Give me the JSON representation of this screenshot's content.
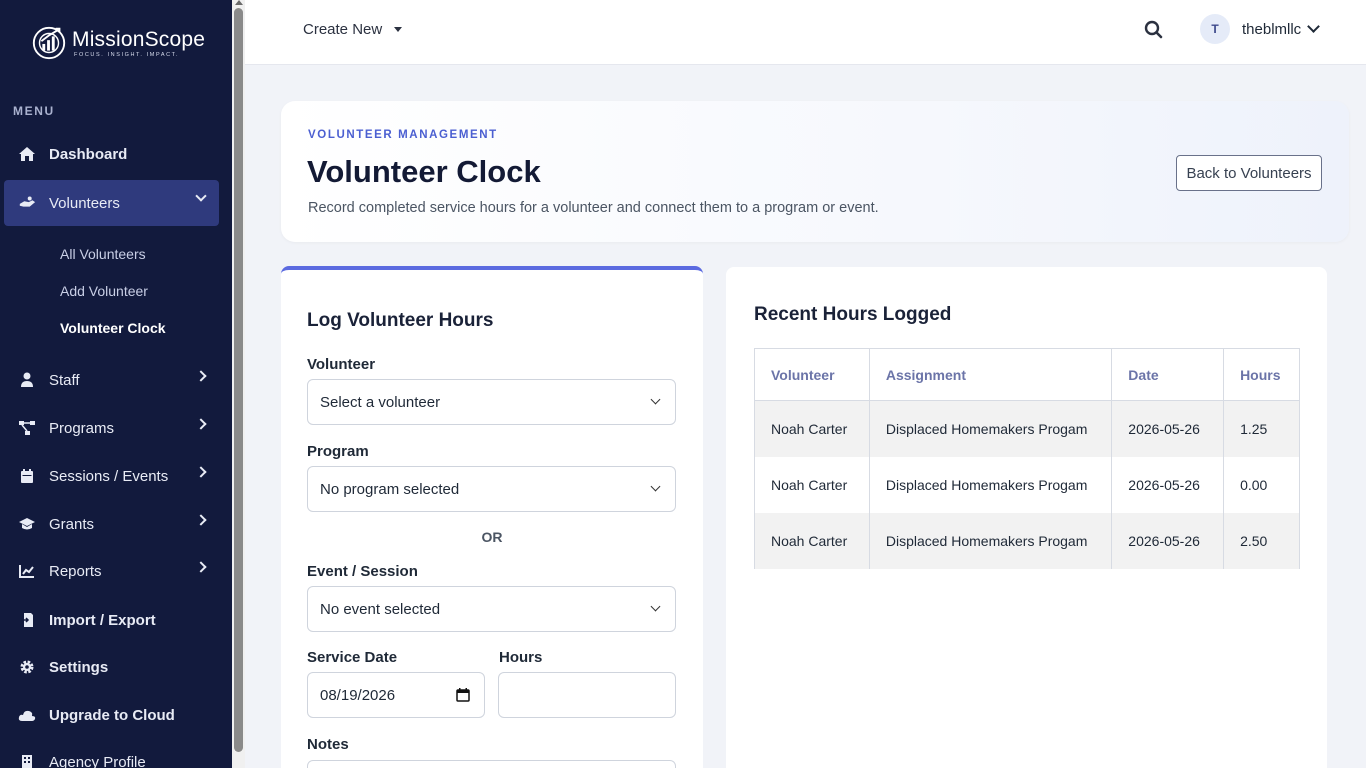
{
  "brand": {
    "name": "MissionScope",
    "tagline": "FOCUS. INSIGHT. IMPACT."
  },
  "sidebar": {
    "menu_label": "MENU",
    "items": [
      {
        "label": "Dashboard",
        "icon": "home-icon"
      },
      {
        "label": "Volunteers",
        "icon": "volunteers-icon"
      },
      {
        "label": "Staff",
        "icon": "user-icon"
      },
      {
        "label": "Programs",
        "icon": "programs-icon"
      },
      {
        "label": "Sessions / Events",
        "icon": "calendar-icon"
      },
      {
        "label": "Grants",
        "icon": "graduation-cap-icon"
      },
      {
        "label": "Reports",
        "icon": "chart-line-icon"
      },
      {
        "label": "Import / Export",
        "icon": "import-export-icon"
      },
      {
        "label": "Settings",
        "icon": "gear-icon"
      },
      {
        "label": "Upgrade to Cloud",
        "icon": "cloud-icon"
      },
      {
        "label": "Agency Profile",
        "icon": "building-icon"
      }
    ],
    "volunteer_sub": [
      "All Volunteers",
      "Add Volunteer",
      "Volunteer Clock"
    ]
  },
  "topbar": {
    "create_new": "Create New",
    "avatar_initial": "T",
    "username": "theblmllc"
  },
  "header": {
    "eyebrow": "VOLUNTEER MANAGEMENT",
    "title": "Volunteer Clock",
    "subtitle": "Record completed service hours for a volunteer and connect them to a program or event.",
    "back_button": "Back to Volunteers"
  },
  "form": {
    "title": "Log Volunteer Hours",
    "volunteer_label": "Volunteer",
    "volunteer_value": "Select a volunteer",
    "program_label": "Program",
    "program_value": "No program selected",
    "or_text": "OR",
    "event_label": "Event / Session",
    "event_value": "No event selected",
    "date_label": "Service Date",
    "date_value": "08/19/2026",
    "hours_label": "Hours",
    "hours_value": "",
    "notes_label": "Notes"
  },
  "recent": {
    "title": "Recent Hours Logged",
    "columns": [
      "Volunteer",
      "Assignment",
      "Date",
      "Hours"
    ],
    "rows": [
      {
        "volunteer": "Noah Carter",
        "assignment": "Displaced Homemakers Progam",
        "date": "2026-05-26",
        "hours": "1.25"
      },
      {
        "volunteer": "Noah Carter",
        "assignment": "Displaced Homemakers Progam",
        "date": "2026-05-26",
        "hours": "0.00"
      },
      {
        "volunteer": "Noah Carter",
        "assignment": "Displaced Homemakers Progam",
        "date": "2026-05-26",
        "hours": "2.50"
      }
    ]
  },
  "colors": {
    "sidebar_bg": "#121a3d",
    "active_item": "#2f3a7d",
    "accent": "#5b6ae0"
  }
}
